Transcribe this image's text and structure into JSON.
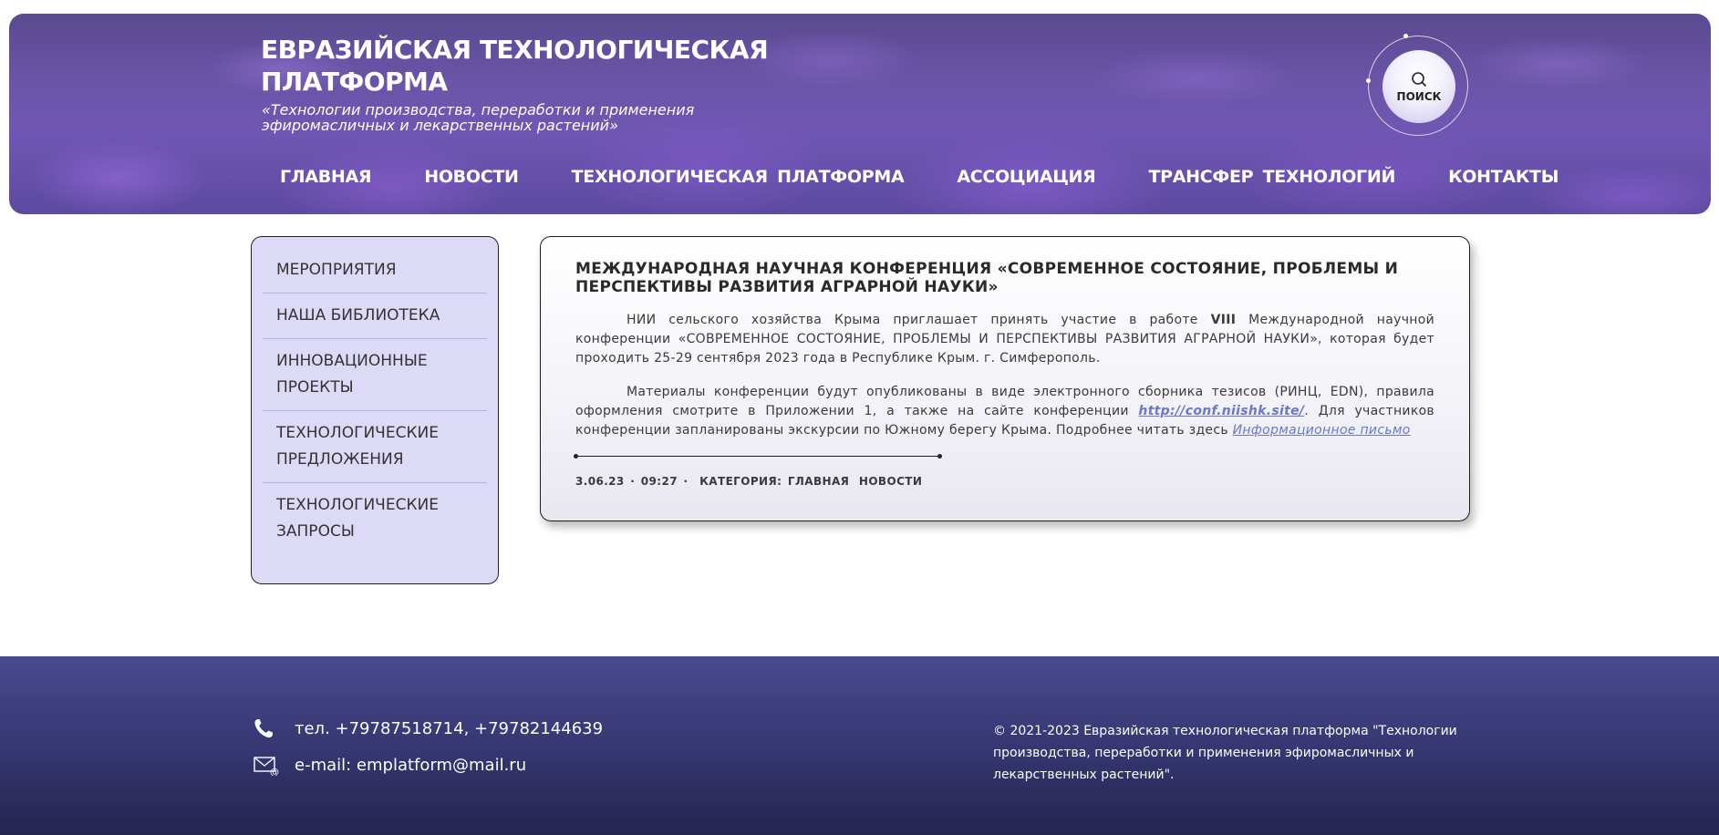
{
  "header": {
    "title": "ЕВРАЗИЙСКАЯ ТЕХНОЛОГИЧЕСКАЯ ПЛАТФОРМА",
    "subtitle": "«Технологии производства, переработки и применения эфиромасличных и лекарственных растений»",
    "search_label": "ПОИСК",
    "nav": [
      {
        "label": "ГЛАВНАЯ"
      },
      {
        "label": "НОВОСТИ"
      },
      {
        "label": "ТЕХНОЛОГИЧЕСКАЯ  ПЛАТФОРМА"
      },
      {
        "label": "АССОЦИАЦИЯ"
      },
      {
        "label": "ТРАНСФЕР  ТЕХНОЛОГИЙ"
      },
      {
        "label": "КОНТАКТЫ"
      }
    ]
  },
  "sidebar": {
    "items": [
      {
        "label": "МЕРОПРИЯТИЯ"
      },
      {
        "label": "НАША БИБЛИОТЕКА"
      },
      {
        "label": "ИННОВАЦИОННЫЕ ПРОЕКТЫ"
      },
      {
        "label": "ТЕХНОЛОГИЧЕСКИЕ ПРЕДЛОЖЕНИЯ"
      },
      {
        "label": "ТЕХНОЛОГИЧЕСКИЕ ЗАПРОСЫ"
      }
    ]
  },
  "article": {
    "title": "МЕЖДУНАРОДНАЯ НАУЧНАЯ КОНФЕРЕНЦИЯ «СОВРЕМЕННОЕ СОСТОЯНИЕ, ПРОБЛЕМЫ И ПЕРСПЕКТИВЫ РАЗВИТИЯ АГРАРНОЙ НАУКИ»",
    "p1_before": "НИИ сельского хозяйства Крыма приглашает принять участие в работе ",
    "p1_bold": "VIII",
    "p1_after": " Международной научной конференции «СОВРЕМЕННОЕ СОСТОЯНИЕ, ПРОБЛЕМЫ И ПЕРСПЕКТИВЫ РАЗВИТИЯ АГРАРНОЙ НАУКИ», которая будет проходить 25-29 сентября 2023 года в Республике Крым. г. Симферополь.",
    "p2_before": "Материалы конференции  будут опубликованы в виде электронного сборника тезисов (РИНЦ, EDN), правила оформления смотрите в Приложении 1, а также на сайте конференции ",
    "p2_link": "http://conf.niishk.site/",
    "p2_after": ". Для участников конференции запланированы экскурсии по Южному берегу Крыма. Подробнее читать здесь ",
    "p2_link2": "Информационное письмо",
    "meta_date": "3.06.23 · 09:27 ·",
    "meta_category": "КАТЕГОРИЯ:",
    "meta_cat1": "ГЛАВНАЯ",
    "meta_cat2": "НОВОСТИ"
  },
  "footer": {
    "phone": "тел. +79787518714, +79782144639",
    "email": "e-mail: emplatform@mail.ru",
    "copyright": "© 2021-2023 Евразийская технологическая платформа \"Технологии производства, переработки и применения эфиромасличных и лекарственных растений\"."
  }
}
